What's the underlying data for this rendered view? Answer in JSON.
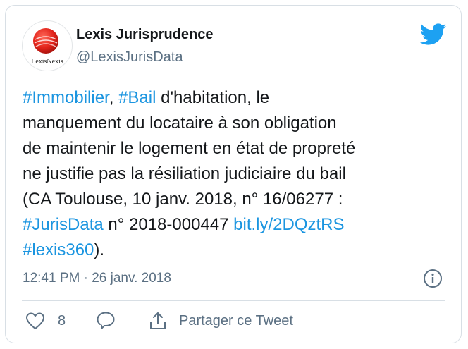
{
  "tweet": {
    "author_name": "Lexis Jurisprudence",
    "author_handle": "@LexisJurisData",
    "avatar_text": "LexisNexis",
    "lines": [
      [
        {
          "t": "#Immobilier",
          "link": true
        },
        {
          "t": ", "
        },
        {
          "t": "#Bail",
          "link": true
        },
        {
          "t": " d'habitation, le"
        }
      ],
      [
        {
          "t": "manquement du locataire à son obligation"
        }
      ],
      [
        {
          "t": "de maintenir le logement en état de propreté"
        }
      ],
      [
        {
          "t": "ne justifie pas la résiliation judiciaire du bail"
        }
      ],
      [
        {
          "t": "(CA Toulouse, 10 janv. 2018, n° 16/06277 :"
        }
      ],
      [
        {
          "t": "#JurisData",
          "link": true
        },
        {
          "t": " n° 2018-000447 "
        },
        {
          "t": "bit.ly/2DQztRS",
          "link": true
        }
      ],
      [
        {
          "t": "#lexis360",
          "link": true
        },
        {
          "t": ")."
        }
      ]
    ],
    "timestamp": "12:41 PM · 26 janv. 2018",
    "like_count": "8",
    "share_label": "Partager ce Tweet"
  },
  "icons": {
    "brand": "twitter-bird-icon",
    "info": "info-icon",
    "like": "heart-icon",
    "reply": "reply-icon",
    "share": "share-icon"
  },
  "colors": {
    "link": "#1b95e0",
    "brand_blue": "#1da1f2",
    "muted": "#5b7083",
    "logo_red": "#e2231a"
  }
}
